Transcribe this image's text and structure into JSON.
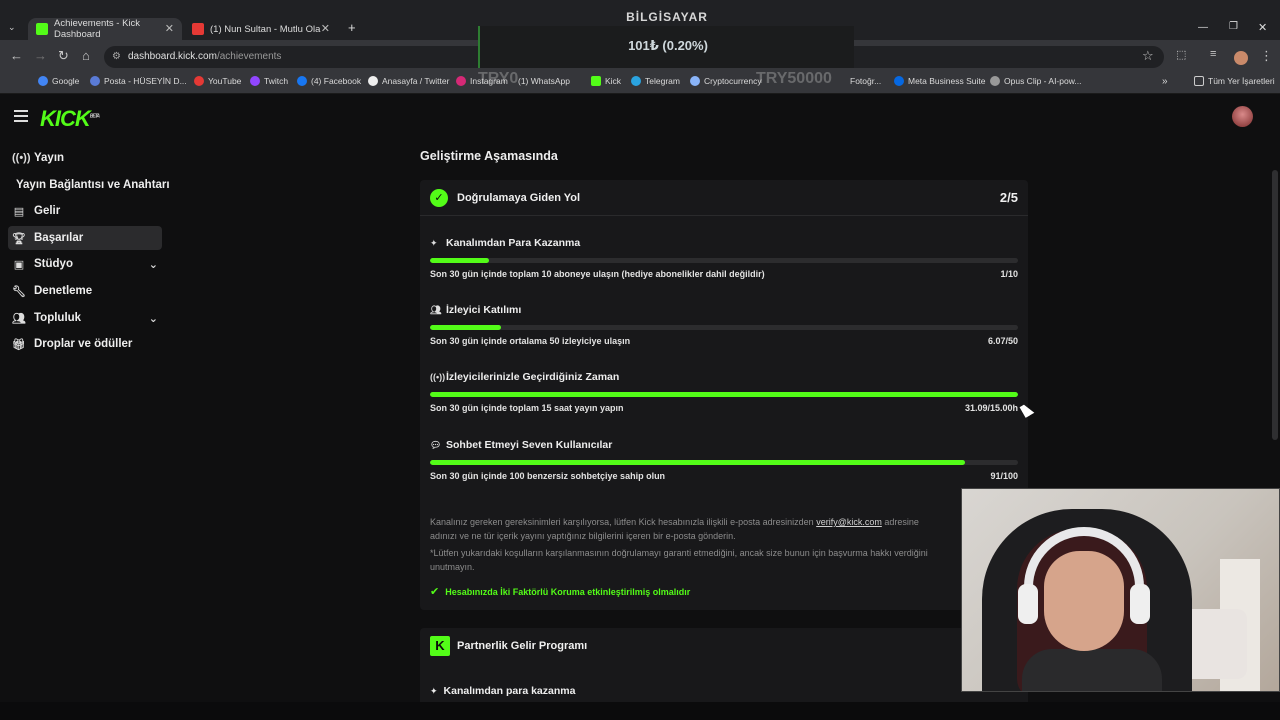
{
  "browser": {
    "tabs": [
      {
        "label": "Achievements - Kick Dashboard",
        "active": true
      },
      {
        "label": "(1) Nun Sultan - Mutlu Ola",
        "active": false
      }
    ],
    "url_host": "dashboard.kick.com",
    "url_path": "/achievements",
    "bookmarks": [
      "Google",
      "Posta - HÜSEYİN D...",
      "YouTube",
      "Twitch",
      "(4) Facebook",
      "Anasayfa / Twitter",
      "Instagram",
      "(1) WhatsApp",
      "Kick",
      "Telegram",
      "Cryptocurrency",
      "Fotoğr...",
      "Meta Business Suite",
      "Opus Clip - AI-pow...",
      "Tüm Yer İşaretleri"
    ]
  },
  "overlay": {
    "title": "BİLGİSAYAR",
    "value": "101₺ (0.20%)",
    "left_ghost": "TRY0",
    "right_ghost": "TRY50000"
  },
  "kick": {
    "logo": "KICK",
    "logo_badge": "BETA"
  },
  "sidebar": {
    "items": [
      {
        "label": "Yayın",
        "icon": "broadcast-icon"
      },
      {
        "label": "Yayın Bağlantısı ve Anahtarı",
        "icon": ""
      },
      {
        "label": "Gelir",
        "icon": "chart-icon"
      },
      {
        "label": "Başarılar",
        "icon": "trophy-icon"
      },
      {
        "label": "Stüdyo",
        "icon": "studio-icon"
      },
      {
        "label": "Denetleme",
        "icon": "wrench-icon"
      },
      {
        "label": "Topluluk",
        "icon": "community-icon"
      },
      {
        "label": "Droplar ve ödüller",
        "icon": "gift-icon"
      }
    ]
  },
  "main": {
    "section_title": "Geliştirme Aşamasında",
    "card1": {
      "title": "Doğrulamaya Giden Yol",
      "count": "2/5",
      "tasks": [
        {
          "title": "Kanalımdan Para Kazanma",
          "desc": "Son 30 gün içinde toplam 10 aboneye ulaşın (hediye abonelikler dahil değildir)",
          "value": "1/10",
          "progress": 0.1
        },
        {
          "title": "İzleyici Katılımı",
          "desc": "Son 30 gün içinde ortalama 50 izleyiciye ulaşın",
          "value": "6.07/50",
          "progress": 0.12
        },
        {
          "title": "İzleyicilerinizle Geçirdiğiniz Zaman",
          "desc": "Son 30 gün içinde toplam 15 saat yayın yapın",
          "value": "31.09/15.00h",
          "progress": 1.0
        },
        {
          "title": "Sohbet Etmeyi Seven Kullanıcılar",
          "desc": "Son 30 gün içinde 100 benzersiz sohbetçiye sahip olun",
          "value": "91/100",
          "progress": 0.91
        }
      ],
      "info_line1_a": "Kanalınız gereken gereksinimleri karşılıyorsa, lütfen Kick hesabınızla ilişkili e-posta adresinizden ",
      "info_link": "verify@kick.com",
      "info_line1_b": " adresine",
      "info_line2": "adınızı ve ne tür içerik yayını yaptığınız bilgilerini içeren bir e-posta gönderin.",
      "info_line3": "*Lütfen yukarıdaki koşulların karşılanmasının doğrulamayı garanti etmediğini, ancak size bunun için başvurma hakkı verdiğini",
      "info_line4": "unutmayın.",
      "check": "Hesabınızda İki Faktörlü Koruma etkinleştirilmiş olmalıdır"
    },
    "card2": {
      "title": "Partnerlik Gelir Programı",
      "first_task": "Kanalımdan para kazanma"
    }
  },
  "colors": {
    "accent": "#53fc18",
    "bg": "#0f0f10",
    "card": "#18181a"
  }
}
